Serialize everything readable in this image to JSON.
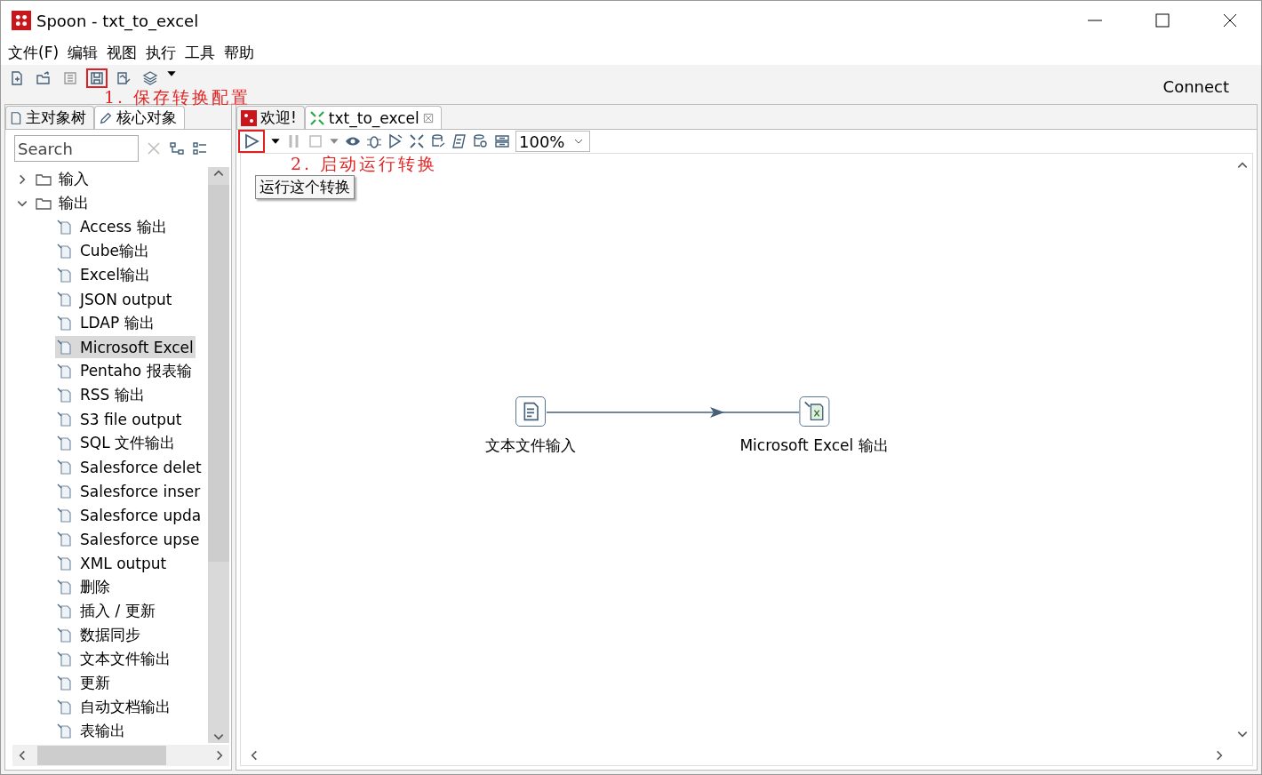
{
  "window": {
    "title": "Spoon - txt_to_excel"
  },
  "menu": [
    "文件(F)",
    "编辑",
    "视图",
    "执行",
    "工具",
    "帮助"
  ],
  "toolbar": {
    "items": [
      {
        "kind": "new",
        "highlighted": false
      },
      {
        "kind": "open",
        "highlighted": false
      },
      {
        "kind": "explore",
        "highlighted": false
      },
      {
        "kind": "save",
        "highlighted": true
      },
      {
        "kind": "save-as",
        "highlighted": false
      },
      {
        "kind": "layers",
        "highlighted": false
      }
    ],
    "connect": "Connect",
    "annotation": "1. 保存转换配置"
  },
  "left_panel": {
    "tabs": [
      {
        "label": "主对象树",
        "selected": false
      },
      {
        "label": "核心对象",
        "selected": true
      }
    ],
    "search": {
      "placeholder": "Search"
    },
    "tree": [
      {
        "label": "输入",
        "expanded": false
      },
      {
        "label": "输出",
        "expanded": true,
        "children": [
          {
            "label": "Access 输出",
            "selected": false
          },
          {
            "label": "Cube输出",
            "selected": false
          },
          {
            "label": "Excel输出",
            "selected": false
          },
          {
            "label": "JSON output",
            "selected": false
          },
          {
            "label": "LDAP 输出",
            "selected": false
          },
          {
            "label": "Microsoft Excel",
            "selected": true
          },
          {
            "label": "Pentaho 报表输",
            "selected": false
          },
          {
            "label": "RSS 输出",
            "selected": false
          },
          {
            "label": "S3 file output",
            "selected": false
          },
          {
            "label": "SQL 文件输出",
            "selected": false
          },
          {
            "label": "Salesforce delet",
            "selected": false
          },
          {
            "label": "Salesforce inser",
            "selected": false
          },
          {
            "label": "Salesforce upda",
            "selected": false
          },
          {
            "label": "Salesforce upse",
            "selected": false
          },
          {
            "label": "XML output",
            "selected": false
          },
          {
            "label": "删除",
            "selected": false
          },
          {
            "label": "插入 / 更新",
            "selected": false
          },
          {
            "label": "数据同步",
            "selected": false
          },
          {
            "label": "文本文件输出",
            "selected": false
          },
          {
            "label": "更新",
            "selected": false
          },
          {
            "label": "自动文档输出",
            "selected": false
          },
          {
            "label": "表输出",
            "selected": false
          }
        ]
      }
    ]
  },
  "editor": {
    "tabs": [
      {
        "label": "欢迎!",
        "kind": "welcome",
        "selected": false
      },
      {
        "label": "txt_to_excel",
        "kind": "transformation",
        "selected": true
      }
    ],
    "run_highlighted": true,
    "zoom": "100%",
    "annotation": "2. 启动运行转换",
    "tooltip": "运行这个转换",
    "nodes": [
      {
        "label": "文本文件输入",
        "kind": "text-input"
      },
      {
        "label": "Microsoft Excel 输出",
        "kind": "excel-output"
      }
    ]
  }
}
